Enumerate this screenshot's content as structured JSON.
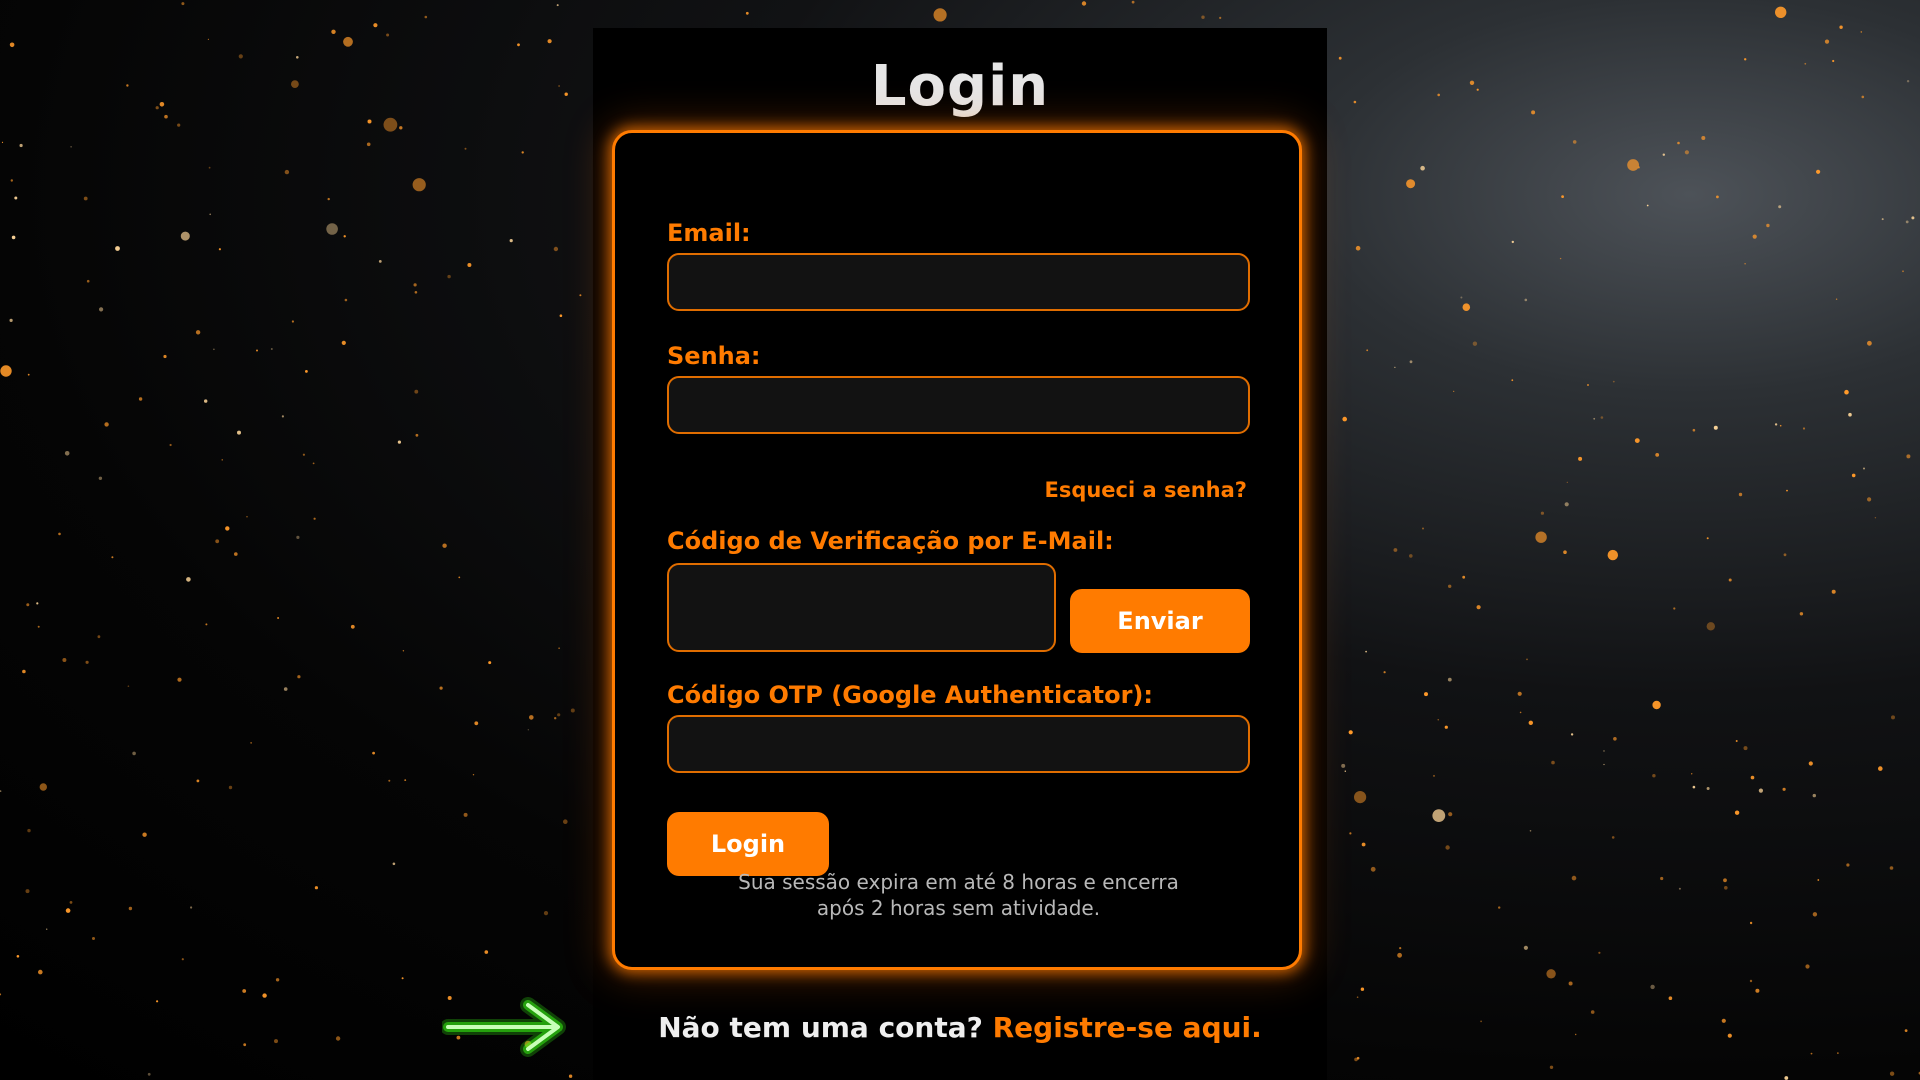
{
  "page": {
    "title": "Login"
  },
  "form": {
    "email_label": "Email:",
    "password_label": "Senha:",
    "forgot_password": "Esqueci a senha?",
    "email_code_label": "Código de Verificação por E-Mail:",
    "send_button": "Enviar",
    "otp_label": "Código OTP (Google Authenticator):",
    "login_button": "Login",
    "session_note_line1": "Sua sessão expira em até 8 horas e encerra",
    "session_note_line2": "após 2 horas sem atividade."
  },
  "footer": {
    "prompt": "Não tem uma conta?",
    "register_link": "Registre-se aqui."
  },
  "colors": {
    "accent": "#ff7b00",
    "panel_background": "#000000",
    "input_background": "#121212",
    "title_text": "#e6e6e6",
    "arrow": "#39ff14"
  },
  "icons": {
    "arrow": "arrow-right-icon"
  }
}
